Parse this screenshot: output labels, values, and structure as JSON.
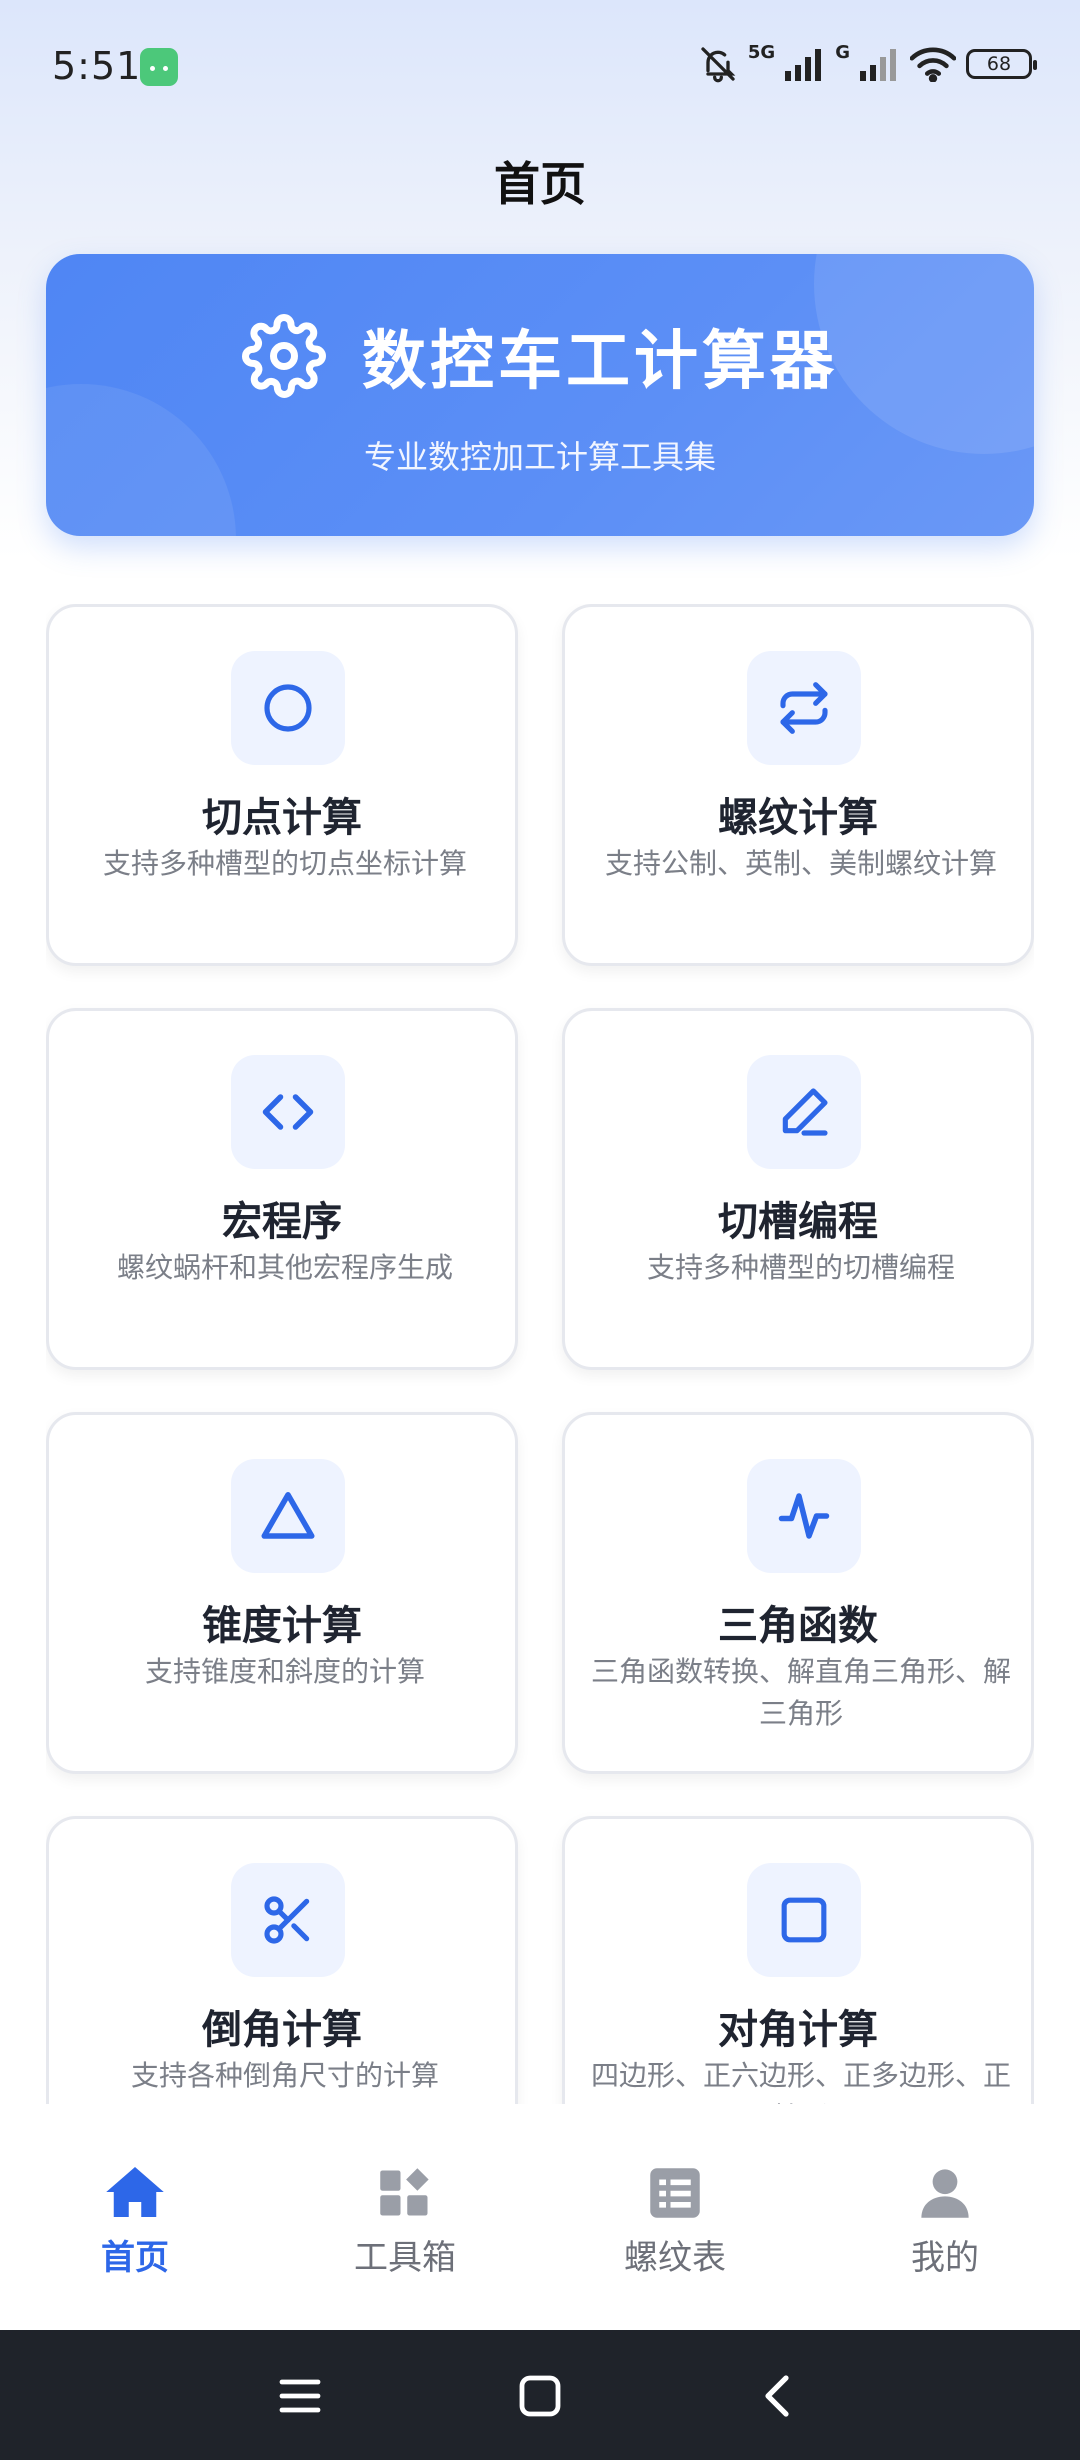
{
  "status_bar": {
    "time": "5:51",
    "net1": "5G",
    "net2": "G",
    "battery": "68"
  },
  "header": {
    "title": "首页"
  },
  "banner": {
    "title": "数控车工计算器",
    "subtitle": "专业数控加工计算工具集",
    "icon": "gear-icon"
  },
  "accent_color": "#2d67e8",
  "cards": [
    {
      "title": "切点计算",
      "desc": "支持多种槽型的切点坐标计算",
      "icon": "circle-icon"
    },
    {
      "title": "螺纹计算",
      "desc": "支持公制、英制、美制螺纹计算",
      "icon": "repeat-arrows-icon"
    },
    {
      "title": "宏程序",
      "desc": "螺纹蜗杆和其他宏程序生成",
      "icon": "code-icon"
    },
    {
      "title": "切槽编程",
      "desc": "支持多种槽型的切槽编程",
      "icon": "pen-icon"
    },
    {
      "title": "锥度计算",
      "desc": "支持锥度和斜度的计算",
      "icon": "triangle-icon"
    },
    {
      "title": "三角函数",
      "desc": "三角函数转换、解直角三角形、解三角形",
      "icon": "pulse-icon"
    },
    {
      "title": "倒角计算",
      "desc": "支持各种倒角尺寸的计算",
      "icon": "scissors-icon"
    },
    {
      "title": "对角计算",
      "desc": "四边形、正六边形、正多边形、正棱形",
      "icon": "square-icon"
    }
  ],
  "tabs": [
    {
      "label": "首页",
      "icon": "home-icon",
      "active": true
    },
    {
      "label": "工具箱",
      "icon": "toolbox-icon",
      "active": false
    },
    {
      "label": "螺纹表",
      "icon": "list-icon",
      "active": false
    },
    {
      "label": "我的",
      "icon": "user-icon",
      "active": false
    }
  ],
  "nav": [
    "menu-icon",
    "home-square-icon",
    "back-icon"
  ]
}
